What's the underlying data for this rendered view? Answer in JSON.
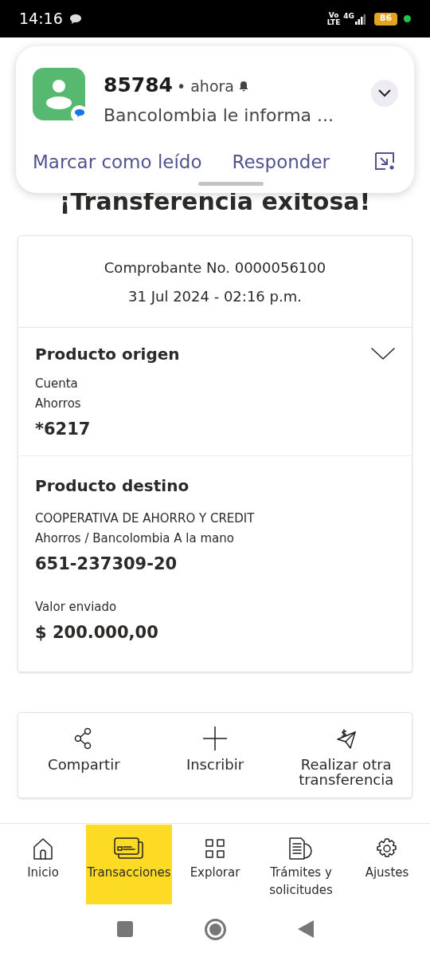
{
  "status_bar": {
    "time": "14:16",
    "network_top": "Vo",
    "network_bottom": "LTE",
    "signal_label": "4G",
    "battery": "86"
  },
  "notification": {
    "sender": "85784",
    "time": "• ahora",
    "message": "Bancolombia le informa ...",
    "actions": [
      "Marcar como leído",
      "Responder"
    ]
  },
  "title": "¡Transferencia exitosa!",
  "receipt": {
    "number": "Comprobante No. 0000056100",
    "date": "31 Jul 2024 - 02:16 p.m.",
    "origin": {
      "heading": "Producto origen",
      "expanded": false,
      "lines": [
        "Cuenta",
        "Ahorros"
      ],
      "value": "*6217"
    },
    "destination": {
      "heading": "Producto destino",
      "lines": [
        "COOPERATIVA DE AHORRO Y CREDIT",
        "Ahorros / Bancolombia A la mano"
      ],
      "value": "651-237309-20",
      "amount_label": "Valor enviado",
      "amount": "$ 200.000,00"
    }
  },
  "actions": [
    {
      "kind": "share",
      "label": "Compartir"
    },
    {
      "kind": "add",
      "label": "Inscribir"
    },
    {
      "kind": "send",
      "label": "Realizar otra transferencia"
    }
  ],
  "bottom_nav": [
    {
      "kind": "home",
      "label": "Inicio",
      "selected": false
    },
    {
      "kind": "cards",
      "label": "Transacciones",
      "selected": true
    },
    {
      "kind": "grid",
      "label": "Explorar",
      "selected": false
    },
    {
      "kind": "docs",
      "label": "Trámites y solicitudes",
      "selected": false
    },
    {
      "kind": "gear",
      "label": "Ajustes",
      "selected": false
    }
  ]
}
